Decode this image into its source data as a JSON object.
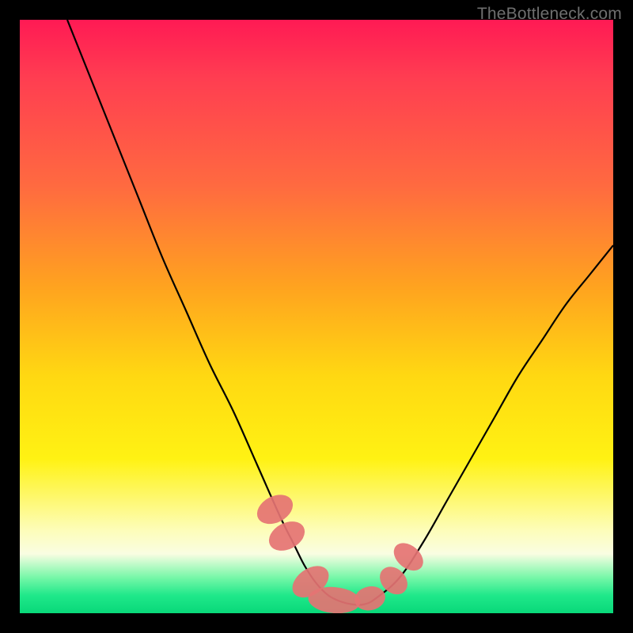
{
  "watermark": "TheBottleneck.com",
  "chart_data": {
    "type": "line",
    "title": "",
    "xlabel": "",
    "ylabel": "",
    "xlim": [
      0,
      100
    ],
    "ylim": [
      0,
      100
    ],
    "grid": false,
    "series": [
      {
        "name": "bottleneck-curve",
        "x": [
          8,
          12,
          16,
          20,
          24,
          28,
          32,
          36,
          40,
          44,
          46,
          48,
          50,
          52,
          54,
          56,
          58,
          60,
          64,
          68,
          72,
          76,
          80,
          84,
          88,
          92,
          96,
          100
        ],
        "values": [
          100,
          90,
          80,
          70,
          60,
          51,
          42,
          34,
          25,
          16,
          12,
          8,
          5,
          3,
          2,
          1.5,
          1.5,
          2.5,
          6,
          12,
          19,
          26,
          33,
          40,
          46,
          52,
          57,
          62
        ]
      }
    ],
    "markers": [
      {
        "name": "marker-a",
        "x": 43,
        "y": 17.5,
        "rx": 2.2,
        "ry": 3.2,
        "rot": 62
      },
      {
        "name": "marker-b",
        "x": 45,
        "y": 13,
        "rx": 2.2,
        "ry": 3.2,
        "rot": 62
      },
      {
        "name": "marker-c",
        "x": 49,
        "y": 5.3,
        "rx": 2.2,
        "ry": 3.4,
        "rot": 55
      },
      {
        "name": "marker-d",
        "x": 53,
        "y": 2.2,
        "rx": 4.4,
        "ry": 2.2,
        "rot": 5
      },
      {
        "name": "marker-e",
        "x": 59,
        "y": 2.5,
        "rx": 2.6,
        "ry": 2.0,
        "rot": -12
      },
      {
        "name": "marker-f",
        "x": 63,
        "y": 5.5,
        "rx": 2.0,
        "ry": 2.6,
        "rot": -45
      },
      {
        "name": "marker-g",
        "x": 65.5,
        "y": 9.5,
        "rx": 1.9,
        "ry": 2.8,
        "rot": -50
      }
    ],
    "marker_color": "#e57373",
    "line_color": "#000000",
    "background_gradient": [
      "#ff1a54",
      "#ffa31f",
      "#fff213",
      "#09d879"
    ]
  }
}
